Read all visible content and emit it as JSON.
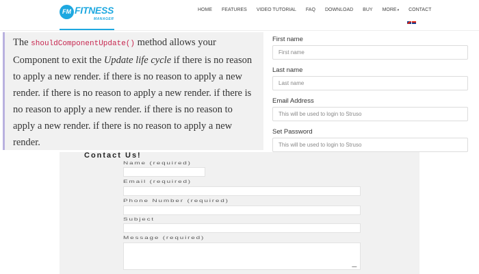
{
  "header": {
    "logo_badge": "FM",
    "logo_main": "FITNESS",
    "logo_sub": "MANAGER",
    "nav": [
      "HOME",
      "FEATURES",
      "VIDEO TUTORIAL",
      "FAQ",
      "DOWNLOAD",
      "BUY",
      "MORE",
      "CONTACT"
    ]
  },
  "quote": {
    "part1": "The ",
    "code": "shouldComponentUpdate()",
    "part2": " method allows your Component to exit the ",
    "em": "Update life cycle",
    "part3": " if there is no reason to apply a new render. if there is no reason to apply a new render. if there is no reason to apply a new render. if there is no reason to apply a new render. if there is no reason to apply a new render. if there is no reason to apply a new render."
  },
  "signup": {
    "first_name_label": "First name",
    "first_name_placeholder": "First name",
    "last_name_label": "Last name",
    "last_name_placeholder": "Last name",
    "email_label": "Email Address",
    "email_placeholder": "This will be used to login to Struso",
    "password_label": "Set Password",
    "password_placeholder": "This will be used to login to Struso"
  },
  "contact": {
    "title": "Contact Us!",
    "name_label": "Name (required)",
    "email_label": "Email (required)",
    "phone_label": "Phone Number (required)",
    "subject_label": "Subject",
    "message_label": "Message (required)"
  }
}
